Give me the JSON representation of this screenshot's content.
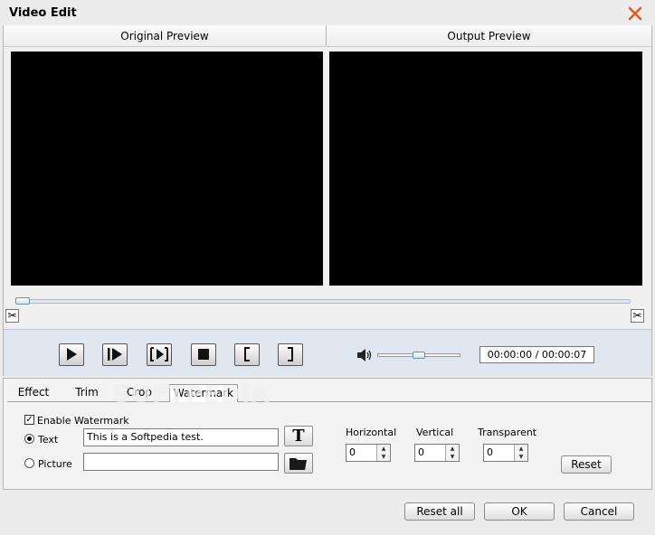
{
  "window": {
    "title": "Video Edit"
  },
  "preview": {
    "original_label": "Original Preview",
    "output_label": "Output Preview"
  },
  "playback": {
    "time_display": "00:00:00 / 00:00:07",
    "seek_progress": 0.0,
    "volume_level": 0.5
  },
  "tabs": [
    {
      "label": "Effect",
      "active": false
    },
    {
      "label": "Trim",
      "active": false
    },
    {
      "label": "Crop",
      "active": false
    },
    {
      "label": "Watermark",
      "active": true
    }
  ],
  "watermark": {
    "enable_label": "Enable Watermark",
    "enable_checked": true,
    "text_option_label": "Text",
    "picture_option_label": "Picture",
    "selected_option": "Text",
    "text_value": "This is a Softpedia test.",
    "picture_value": "",
    "horizontal_label": "Horizontal",
    "horizontal_value": "0",
    "vertical_label": "Vertical",
    "vertical_value": "0",
    "transparent_label": "Transparent",
    "transparent_value": "0",
    "reset_label": "Reset"
  },
  "footer": {
    "reset_all_label": "Reset all",
    "ok_label": "OK",
    "cancel_label": "Cancel"
  },
  "overlay": {
    "watermark_text": "SOFTPEDIA"
  },
  "colors": {
    "close_icon": "#e05a1e",
    "video_bg": "#000000",
    "control_bar": "#dfe7f1"
  }
}
